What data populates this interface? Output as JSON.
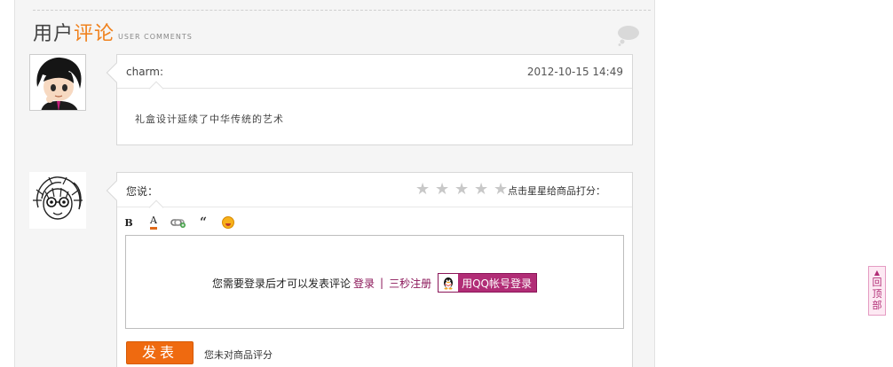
{
  "section": {
    "title_part1": "用户",
    "title_part2": "评论",
    "title_en": "USER COMMENTS"
  },
  "comments": [
    {
      "author": "charm:",
      "date": "2012-10-15 14:49",
      "text": "礼盒设计延续了中华传统的艺术"
    }
  ],
  "form": {
    "label": "您说：",
    "stars": [
      "★",
      "★",
      "★",
      "★",
      "★"
    ],
    "rate_hint": "点击星星给商品打分：",
    "toolbar": {
      "bold": "B",
      "font_color": "A",
      "quote": "“"
    },
    "login_prompt": "您需要登录后才可以发表评论",
    "login_link": "登录",
    "separator": "|",
    "register_link": "三秒注册",
    "qq_login": "用QQ帐号登录",
    "submit": "发表",
    "rating_status": "您未对商品评分"
  },
  "back_to_top": {
    "arrow": "▲",
    "chars": [
      "回",
      "顶",
      "部"
    ]
  },
  "colors": {
    "accent": "#f0821e",
    "link": "#8a1558",
    "submit": "#ef6a10",
    "qq_button": "#b12d76"
  }
}
